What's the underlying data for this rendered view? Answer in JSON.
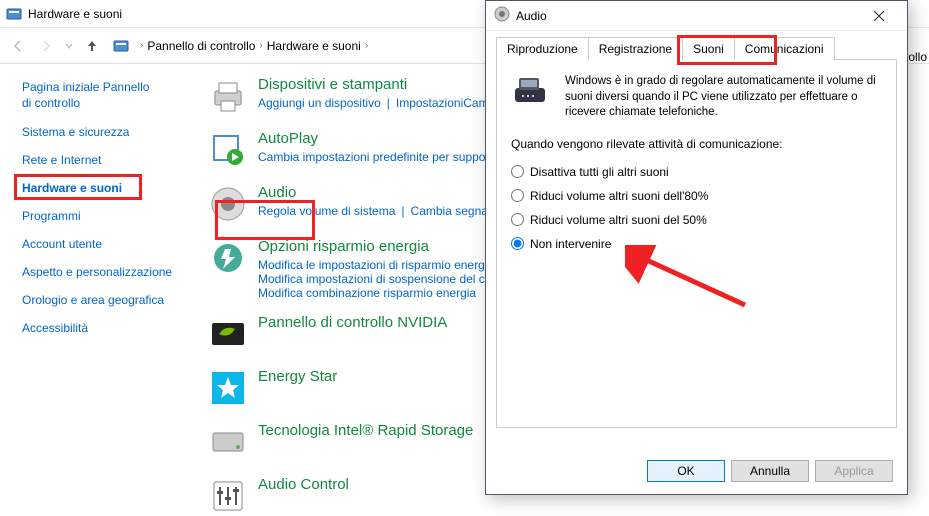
{
  "window": {
    "title": "Hardware e suoni",
    "breadcrumb": [
      "Pannello di controllo",
      "Hardware e suoni"
    ]
  },
  "sidebar": {
    "items": [
      {
        "label": "Pagina iniziale Pannello di controllo",
        "current": false
      },
      {
        "label": "Sistema e sicurezza",
        "current": false
      },
      {
        "label": "Rete e Internet",
        "current": false
      },
      {
        "label": "Hardware e suoni",
        "current": true
      },
      {
        "label": "Programmi",
        "current": false
      },
      {
        "label": "Account utente",
        "current": false
      },
      {
        "label": "Aspetto e personalizzazione",
        "current": false
      },
      {
        "label": "Orologio e area geografica",
        "current": false
      },
      {
        "label": "Accessibilità",
        "current": false
      }
    ]
  },
  "categories": [
    {
      "title": "Dispositivi e stampanti",
      "links": [
        "Aggiungi un dispositivo",
        "Impostazioni",
        "Cambia opzioni di avvio Windows To Go"
      ]
    },
    {
      "title": "AutoPlay",
      "links": [
        "Cambia impostazioni predefinite per suppo"
      ]
    },
    {
      "title": "Audio",
      "links": [
        "Regola volume di sistema",
        "Cambia segna"
      ]
    },
    {
      "title": "Opzioni risparmio energia",
      "links": [
        "Modifica le impostazioni di risparmio energ",
        "Modifica impostazioni di sospensione del c",
        "Modifica combinazione risparmio energia"
      ]
    },
    {
      "title": "Pannello di controllo NVIDIA",
      "links": []
    },
    {
      "title": "Energy Star",
      "links": []
    },
    {
      "title": "Tecnologia Intel® Rapid Storage",
      "links": []
    },
    {
      "title": "Audio Control",
      "links": []
    }
  ],
  "dialog": {
    "title": "Audio",
    "tabs": [
      "Riproduzione",
      "Registrazione",
      "Suoni",
      "Comunicazioni"
    ],
    "active_tab": 3,
    "description": "Windows è in grado di regolare automaticamente il volume di suoni diversi quando il PC viene utilizzato per effettuare o ricevere chiamate telefoniche.",
    "question": "Quando vengono rilevate attività di comunicazione:",
    "options": [
      "Disattiva tutti gli altri suoni",
      "Riduci volume altri suoni dell'80%",
      "Riduci volume altri suoni del 50%",
      "Non intervenire"
    ],
    "selected_option": 3,
    "buttons": {
      "ok": "OK",
      "cancel": "Annulla",
      "apply": "Applica"
    }
  },
  "offscreen": "trollo"
}
